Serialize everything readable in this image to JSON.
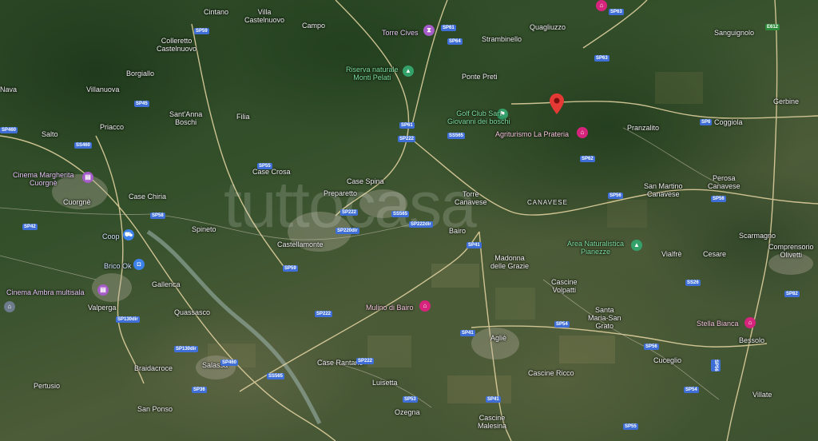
{
  "watermark": "tuttocasa",
  "colors": {
    "road_major": "#e8d7a4",
    "road_minor": "#c8c2b0",
    "river": "#9ab0a8",
    "pin": "#e53935",
    "poi_green": "#34a06a",
    "poi_pink": "#d6247c",
    "poi_purple": "#a65cc8",
    "poi_blue": "#3d82e8",
    "shield": "#3f6fd6"
  },
  "places": {
    "cintano": "Cintano",
    "villa_castelnuovo": "Villa\nCastelnuovo",
    "campo": "Campo",
    "quagliuzzo": "Quagliuzzo",
    "sanguignolo": "Sanguignolo",
    "colleretto": "Colleretto\nCastelnuovo",
    "strambinello": "Strambinello",
    "borgiallo": "Borgiallo",
    "villanuova": "Villanuova",
    "nava": "Nava",
    "ponte_preti": "Ponte Preti",
    "gerbine": "Gerbine",
    "santanna": "Sant'Anna\nBoschi",
    "filia": "Filia",
    "coggiola": "Coggiola",
    "salto": "Salto",
    "priacco": "Priacco",
    "pranzalito": "Pranzalito",
    "case_crosa": "Case Crosa",
    "perosa": "Perosa\nCanavese",
    "cuorgne": "Cuorgnè",
    "case_spina": "Case Spina",
    "preparetto": "Preparetto",
    "torre_canavese": "Torre\nCanavese",
    "san_martino": "San Martino\nCanavese",
    "canavese": "CANAVESE",
    "case_chiria": "Case Chiria",
    "spineto": "Spineto",
    "bairo": "Bairo",
    "scarmagno": "Scarmagno",
    "castellamonte": "Castellamonte",
    "vialfre": "Vialfrè",
    "cesare": "Cesare",
    "madonna": "Madonna\ndelle Grazie",
    "gallenca": "Gallenca",
    "cascine_volpatti": "Cascine\nVolpatti",
    "valperga": "Valperga",
    "quassasco": "Quassasco",
    "santa_maria": "Santa\nMaria-San\nGrato",
    "bessolo": "Bessolo",
    "aglie": "Agliè",
    "salassa": "Salassa",
    "case_rantano": "Case Rantano",
    "braidacroce": "Braidacroce",
    "cuceglio": "Cuceglio",
    "cascine_ricco": "Cascine Ricco",
    "luisetta": "Luisetta",
    "pertusio": "Pertusio",
    "villate": "Villate",
    "san_ponso": "San Ponso",
    "ozegna": "Ozegna",
    "cascine_malesina": "Cascine\nMalesina"
  },
  "pois": {
    "torre_cives": "Torre Cives",
    "riserva": "Riserva naturale\nMonti Pelati",
    "golf_club": "Golf Club San\nGiovanni dei boschi",
    "agriturismo": "Agriturismo La Prateria",
    "cinema_margherita": "Cinema Margherita\nCuorgnè",
    "coop": "Coop",
    "brico": "Brico Ok",
    "cinema_ambra": "Cinema Ambra multisala",
    "area_naturalistica": "Area Naturalistica\nPianezze",
    "mulino": "Mulino di Bairo",
    "stella_bianca": "Stella Bianca",
    "comprensorio": "Comprensorio\nOlivetti"
  },
  "roads": {
    "sp59a": "SP59",
    "sp61a": "SP61",
    "sp64": "SP64",
    "sp63a": "SP63",
    "sp63b": "SP63",
    "a5": "E612",
    "sp45": "SP45",
    "sp61b": "SP61",
    "sp222a": "SP222",
    "ss565a": "SS565",
    "sp6a": "SP6",
    "ss460a": "SS460",
    "sp62": "SP62",
    "sp55": "SP55",
    "sp460": "SP460",
    "sp56a": "SP56",
    "sp56b": "SP56",
    "sp222b": "SP222",
    "ss565b": "SS565",
    "sp58a": "SP58",
    "sp42": "SP42",
    "sp220": "SP220dir",
    "sp222dir": "SP222dir",
    "sp41a": "SP41",
    "sp59b": "SP59",
    "sp56c": "SS26",
    "sp222c": "SP222",
    "sp130": "SP130dir",
    "sp41b": "SP41",
    "sp54": "SP54",
    "sp56d": "SP56",
    "sp82": "SP82",
    "sp130b": "SP130dir",
    "sp460b": "SP460",
    "sp222d": "SP222",
    "ss565c": "SS565",
    "sp36": "SP36",
    "sp53": "SP53",
    "sp41c": "SP41",
    "sp54b": "SP54",
    "sp55b": "SP55",
    "sp56e": "SP56"
  }
}
